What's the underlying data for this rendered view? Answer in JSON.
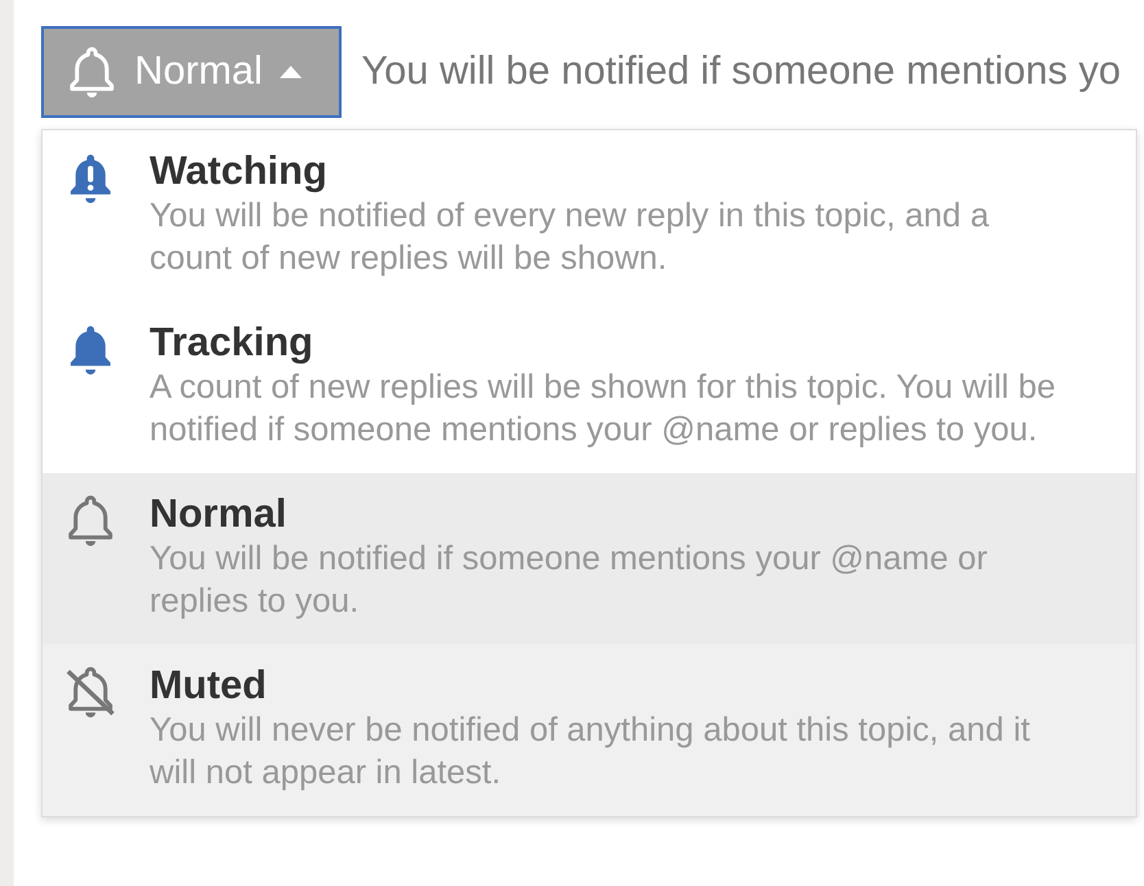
{
  "button": {
    "label": "Normal",
    "expanded": true,
    "kind": "normal"
  },
  "current_description": "You will be notified if someone mentions yo",
  "options": [
    {
      "kind": "watching",
      "title": "Watching",
      "description": "You will be notified of every new reply in this topic, and a count of new replies will be shown.",
      "selected": false,
      "hovered": false
    },
    {
      "kind": "tracking",
      "title": "Tracking",
      "description": "A count of new replies will be shown for this topic. You will be notified if someone mentions your @name or replies to you.",
      "selected": false,
      "hovered": false
    },
    {
      "kind": "normal",
      "title": "Normal",
      "description": "You will be notified if someone mentions your @name or replies to you.",
      "selected": true,
      "hovered": false
    },
    {
      "kind": "muted",
      "title": "Muted",
      "description": "You will never be notified of anything about this topic, and it will not appear in latest.",
      "selected": false,
      "hovered": true
    }
  ]
}
